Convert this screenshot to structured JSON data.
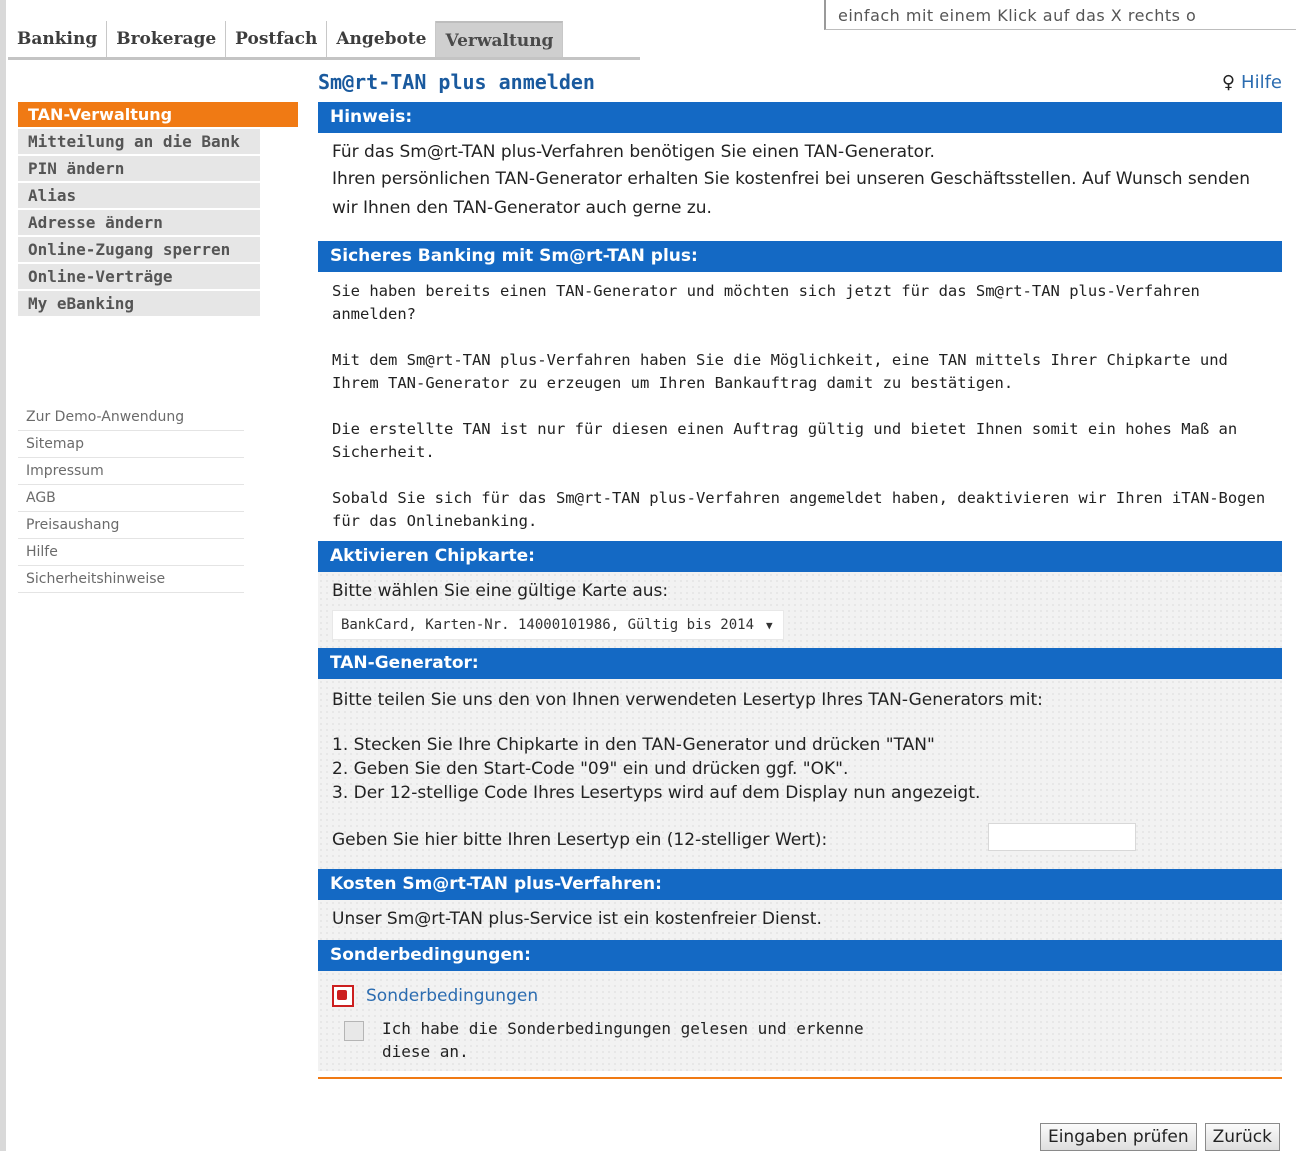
{
  "top_notice": "einfach mit einem Klick auf das X rechts o",
  "tabs": [
    {
      "label": "Banking",
      "active": false
    },
    {
      "label": "Brokerage",
      "active": false
    },
    {
      "label": "Postfach",
      "active": false
    },
    {
      "label": "Angebote",
      "active": false
    },
    {
      "label": "Verwaltung",
      "active": true
    }
  ],
  "sidebar": {
    "items": [
      {
        "label": "TAN-Verwaltung",
        "active": true
      },
      {
        "label": "Mitteilung an die Bank",
        "active": false
      },
      {
        "label": "PIN ändern",
        "active": false
      },
      {
        "label": "Alias",
        "active": false
      },
      {
        "label": "Adresse ändern",
        "active": false
      },
      {
        "label": "Online-Zugang sperren",
        "active": false
      },
      {
        "label": "Online-Verträge",
        "active": false
      },
      {
        "label": "My eBanking",
        "active": false
      }
    ],
    "links": [
      "Zur Demo-Anwendung",
      "Sitemap",
      "Impressum",
      "AGB",
      "Preisaushang",
      "Hilfe",
      "Sicherheitshinweise"
    ]
  },
  "page": {
    "title": "Sm@rt-TAN plus anmelden",
    "help_label": "Hilfe"
  },
  "hinweis": {
    "heading": "Hinweis:",
    "line1": "Für das Sm@rt-TAN plus-Verfahren benötigen Sie einen TAN-Generator.",
    "line2": "Ihren persönlichen TAN-Generator erhalten Sie kostenfrei bei unseren Geschäftsstellen. Auf Wunsch senden wir Ihnen den TAN-Generator auch gerne zu."
  },
  "sicheres": {
    "heading": "Sicheres Banking mit Sm@rt-TAN plus:",
    "p1": "Sie haben bereits einen TAN-Generator und möchten sich jetzt für das Sm@rt-TAN plus-Verfahren anmelden?",
    "p2": "Mit dem Sm@rt-TAN plus-Verfahren haben Sie die Möglichkeit, eine TAN mittels Ihrer Chipkarte und Ihrem TAN-Generator zu erzeugen um Ihren Bankauftrag damit zu bestätigen.",
    "p3": "Die erstellte TAN ist nur für diesen einen Auftrag gültig und bietet Ihnen somit ein hohes Maß an Sicherheit.",
    "p4": "Sobald Sie sich für das Sm@rt-TAN plus-Verfahren angemeldet haben, deaktivieren wir Ihren iTAN-Bogen für das Onlinebanking."
  },
  "chipkarte": {
    "heading": "Aktivieren Chipkarte:",
    "prompt": "Bitte wählen Sie eine gültige Karte aus:",
    "selected": "BankCard, Karten-Nr. 14000101986, Gültig bis 2014"
  },
  "generator": {
    "heading": "TAN-Generator:",
    "intro": "Bitte teilen Sie uns den von Ihnen verwendeten Lesertyp Ihres TAN-Generators mit:",
    "steps": [
      "1. Stecken Sie Ihre Chipkarte in den TAN-Generator und drücken \"TAN\"",
      "2. Geben Sie den Start-Code \"09\" ein und drücken ggf. \"OK\".",
      "3. Der 12-stellige Code Ihres Lesertyps wird auf dem Display nun angezeigt."
    ],
    "input_label": "Geben Sie hier bitte Ihren Lesertyp ein (12-stelliger Wert):",
    "input_value": ""
  },
  "kosten": {
    "heading": "Kosten Sm@rt-TAN plus-Verfahren:",
    "text": "Unser Sm@rt-TAN plus-Service ist ein kostenfreier Dienst."
  },
  "sonder": {
    "heading": "Sonderbedingungen:",
    "link": "Sonderbedingungen",
    "checkbox_label": "Ich habe die Sonderbedingungen gelesen und erkenne diese an.",
    "checked": false
  },
  "buttons": {
    "check": "Eingaben prüfen",
    "back": "Zurück"
  }
}
